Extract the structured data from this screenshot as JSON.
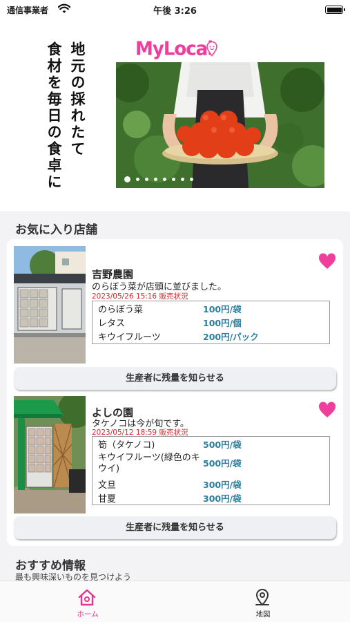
{
  "status_bar": {
    "carrier": "通信事業者",
    "time": "午後 3:26"
  },
  "hero": {
    "tagline_lines": [
      "地元の採れたて",
      "食材を毎日の食卓に"
    ],
    "brand": "MyLocal",
    "carousel_pages": 8,
    "carousel_active": 1
  },
  "favorites": {
    "title": "お気に入り店舗",
    "shops": [
      {
        "name": "吉野農園",
        "message": "のらぼう菜が店頭に並びました。",
        "timestamp": "2023/05/26 15:16 販売状況",
        "items": [
          {
            "item": "のらぼう菜",
            "price": "100円/袋"
          },
          {
            "item": "レタス",
            "price": "100円/個"
          },
          {
            "item": "キウイフルーツ",
            "price": "200円/パック"
          }
        ],
        "notify_label": "生産者に残量を知らせる"
      },
      {
        "name": "よしの園",
        "message": "タケノコは今が旬です。",
        "timestamp": "2023/05/12 18:59 販売状況",
        "items": [
          {
            "item": "筍（タケノコ)",
            "price": "500円/袋"
          },
          {
            "item": "キウイフルーツ(緑色のキウイ)",
            "price": "500円/袋"
          },
          {
            "item": "文旦",
            "price": "300円/袋"
          },
          {
            "item": "甘夏",
            "price": "300円/袋"
          }
        ],
        "notify_label": "生産者に残量を知らせる"
      }
    ]
  },
  "recommend": {
    "title": "おすすめ情報",
    "subtitle": "最も興味深いものを見つけよう"
  },
  "tabs": [
    {
      "label": "ホーム",
      "icon": "home-icon",
      "active": true
    },
    {
      "label": "地図",
      "icon": "map-pin-icon",
      "active": false
    }
  ],
  "colors": {
    "brand_pink": "#ee3f9c",
    "price_blue": "#2b7e9c",
    "timestamp_red": "#e0262a"
  }
}
